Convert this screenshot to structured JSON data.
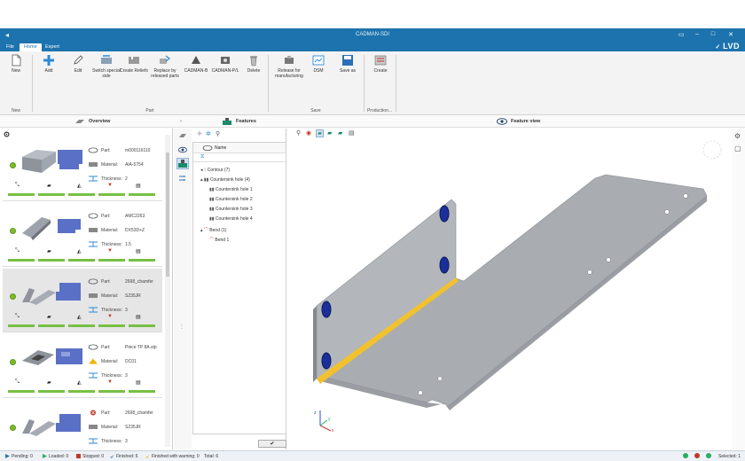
{
  "window": {
    "title": "CADMAN-SDI",
    "brand": "LVD"
  },
  "tabs": [
    {
      "label": "File"
    },
    {
      "label": "Home"
    },
    {
      "label": "Expert"
    }
  ],
  "ribbon": {
    "buttons": [
      {
        "label": "New",
        "icon": "new-file-icon"
      },
      {
        "label": "Add",
        "icon": "add-icon"
      },
      {
        "label": "Edit",
        "icon": "edit-icon"
      },
      {
        "label": "Switch special side",
        "icon": "switch-side-icon"
      },
      {
        "label": "Create Reliefs",
        "icon": "reliefs-icon"
      },
      {
        "label": "Replace by released parts",
        "icon": "replace-icon"
      },
      {
        "label": "CADMAN-B",
        "icon": "cadman-b-icon"
      },
      {
        "label": "CADMAN-P/L",
        "icon": "cadman-pl-icon"
      },
      {
        "label": "Delete",
        "icon": "delete-icon"
      },
      {
        "label": "Release for manufacturing",
        "icon": "release-icon"
      },
      {
        "label": "DSM",
        "icon": "dsm-icon"
      },
      {
        "label": "Save as",
        "icon": "save-as-icon"
      },
      {
        "label": "Create",
        "icon": "create-icon"
      }
    ],
    "groups": [
      {
        "label": "New"
      },
      {
        "label": "Part"
      },
      {
        "label": "Save"
      },
      {
        "label": "Production..."
      }
    ]
  },
  "panes": {
    "overview": "Overview",
    "features": "Features",
    "feature_view": "Feature view"
  },
  "overview": {
    "field_labels": {
      "part": "Part:",
      "material": "Material:",
      "thickness": "Thickness:"
    },
    "parts": [
      {
        "part": "m000116110",
        "material": "AlA-5754",
        "thickness": "2",
        "status": "ok"
      },
      {
        "part": "AMC2263",
        "material": "DX53D+Z",
        "thickness": "1.5",
        "status": "ok"
      },
      {
        "part": "2698_chamfer",
        "material": "S235JR",
        "thickness": "3",
        "status": "ok",
        "selected": true
      },
      {
        "part": "Pièce TP 8A.stp",
        "material": "DC01",
        "thickness": "3",
        "status": "ok",
        "material_warning": true
      },
      {
        "part": "2698_chamfer",
        "material": "S235JR",
        "thickness": "3",
        "status": "ok",
        "part_error": true
      }
    ]
  },
  "features": {
    "column": "Name",
    "tree": [
      {
        "label": "Contour (7)",
        "level": 0
      },
      {
        "label": "Countersink hole (4)",
        "level": 0
      },
      {
        "label": "Countersink hole 1",
        "level": 1
      },
      {
        "label": "Countersink hole 2",
        "level": 1
      },
      {
        "label": "Countersink hole 3",
        "level": 1
      },
      {
        "label": "Countersink hole 4",
        "level": 1
      },
      {
        "label": "Bend (1)",
        "level": 0
      },
      {
        "label": "Bend 1",
        "level": 1
      }
    ],
    "ok_glyph": "✔"
  },
  "viewport": {
    "axes": {
      "x": "x",
      "y": "y",
      "z": "z"
    }
  },
  "status": {
    "pending": "Pending: 0",
    "loaded": "Loaded: 0",
    "stopped": "Stopped: 0",
    "finished": "Finished: 6",
    "finished_warning": "Finished with warning: 0",
    "total": "Total: 6",
    "selected": "Selected: 1"
  },
  "colors": {
    "accent": "#1d73ad",
    "ok_green": "#77c044",
    "bend_yellow": "#f2c12e",
    "hole_blue": "#1b2f9a"
  }
}
